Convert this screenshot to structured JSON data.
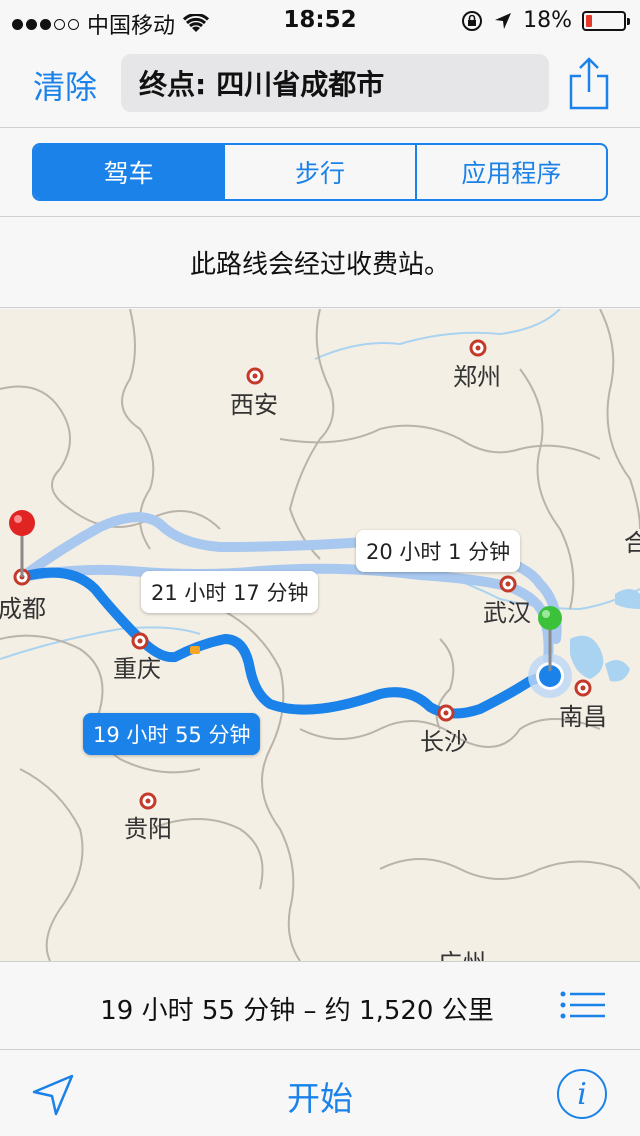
{
  "status_bar": {
    "carrier": "中国移动",
    "time": "18:52",
    "battery_percent": "18%",
    "battery_level": 0.18,
    "signal_bars_filled": 3,
    "signal_bars_total": 5
  },
  "nav": {
    "clear_label": "清除",
    "destination_prefix": "终点:",
    "destination_value": "四川省成都市"
  },
  "segments": [
    {
      "label": "驾车",
      "selected": true
    },
    {
      "label": "步行",
      "selected": false
    },
    {
      "label": "应用程序",
      "selected": false
    }
  ],
  "notice": "此路线会经过收费站。",
  "map": {
    "cities": {
      "xian": "西安",
      "zhengzhou": "郑州",
      "chengdu": "成都",
      "chongqing": "重庆",
      "wuhan": "武汉",
      "changsha": "长沙",
      "nanchang": "南昌",
      "guiyang": "贵阳",
      "guangzhou_partial": "广州",
      "hefei_partial": "合"
    },
    "routes": [
      {
        "label": "19 小时 55 分钟",
        "selected": true
      },
      {
        "label": "21 小时 17 分钟",
        "selected": false
      },
      {
        "label": "20 小时 1 分钟",
        "selected": false
      }
    ],
    "colors": {
      "route_selected": "#1a82e8",
      "route_alternate": "#a9c8ef",
      "destination_pin": "#e02424",
      "start_pin": "#3cc13b"
    }
  },
  "summary": {
    "text": "19 小时 55 分钟 – 约 1,520 公里",
    "list_icon": "list-icon"
  },
  "toolbar": {
    "location_icon": "location-arrow-icon",
    "start_label": "开始",
    "info_icon": "info-icon",
    "info_glyph": "i"
  },
  "colors": {
    "accent": "#1a82e8"
  }
}
